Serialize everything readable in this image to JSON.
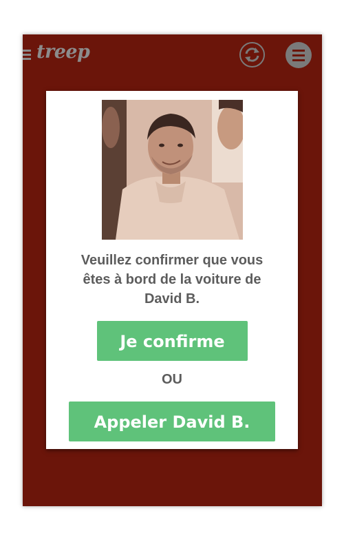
{
  "app": {
    "logo_text": "treep",
    "icons": [
      "menu-icon",
      "sync-icon",
      "menu-circle-icon"
    ]
  },
  "dialog": {
    "message": "Veuillez confirmer que vous êtes à bord de la voiture de David B.",
    "confirm_label": "Je confirme",
    "or_label": "OU",
    "call_label": "Appeler David B."
  },
  "colors": {
    "background": "#6b150a",
    "button": "#5fc27a",
    "text": "#5c5c5c",
    "icon": "#7a7a7a"
  }
}
